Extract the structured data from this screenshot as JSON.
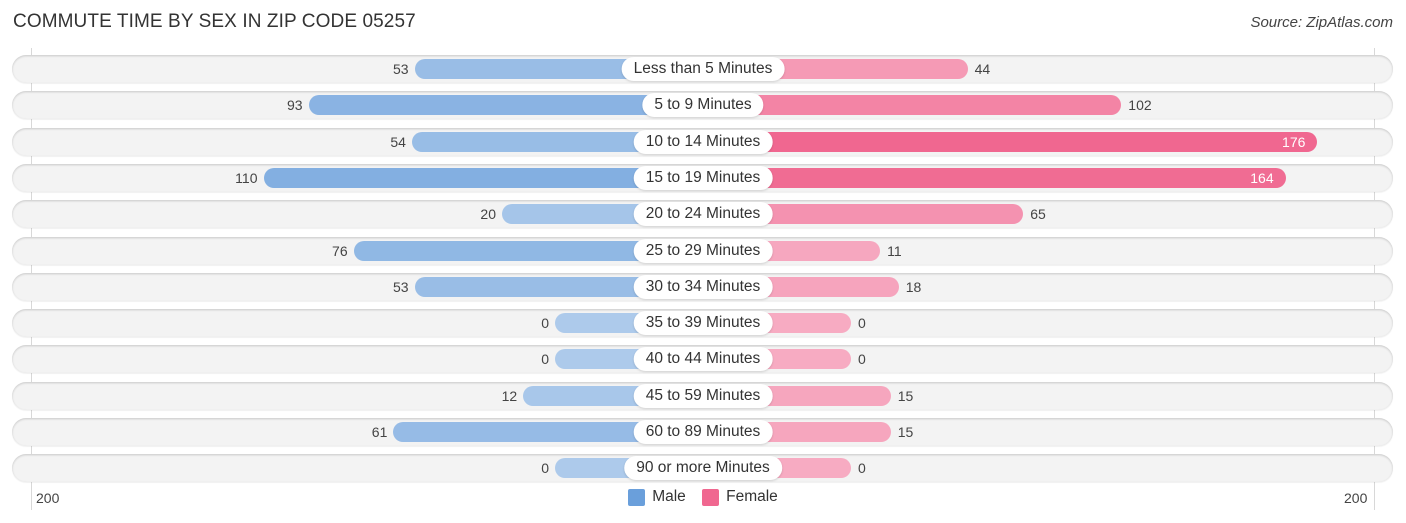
{
  "chart_data": {
    "type": "bar",
    "orientation": "horizontal-diverging",
    "title": "COMMUTE TIME BY SEX IN ZIP CODE 05257",
    "source": "Source: ZipAtlas.com",
    "categories": [
      "Less than 5 Minutes",
      "5 to 9 Minutes",
      "10 to 14 Minutes",
      "15 to 19 Minutes",
      "20 to 24 Minutes",
      "25 to 29 Minutes",
      "30 to 34 Minutes",
      "35 to 39 Minutes",
      "40 to 44 Minutes",
      "45 to 59 Minutes",
      "60 to 89 Minutes",
      "90 or more Minutes"
    ],
    "series": [
      {
        "name": "Male",
        "color": "#6a9fdb",
        "values": [
          53,
          93,
          54,
          110,
          20,
          76,
          53,
          0,
          0,
          12,
          61,
          0
        ]
      },
      {
        "name": "Female",
        "color": "#f06790",
        "values": [
          44,
          102,
          176,
          164,
          65,
          11,
          18,
          0,
          0,
          15,
          15,
          0
        ]
      }
    ],
    "axis": {
      "left_tick": "200",
      "right_tick": "200",
      "range": [
        0,
        200
      ]
    },
    "legend": {
      "position": "bottom-center",
      "items": [
        "Male",
        "Female"
      ]
    }
  }
}
